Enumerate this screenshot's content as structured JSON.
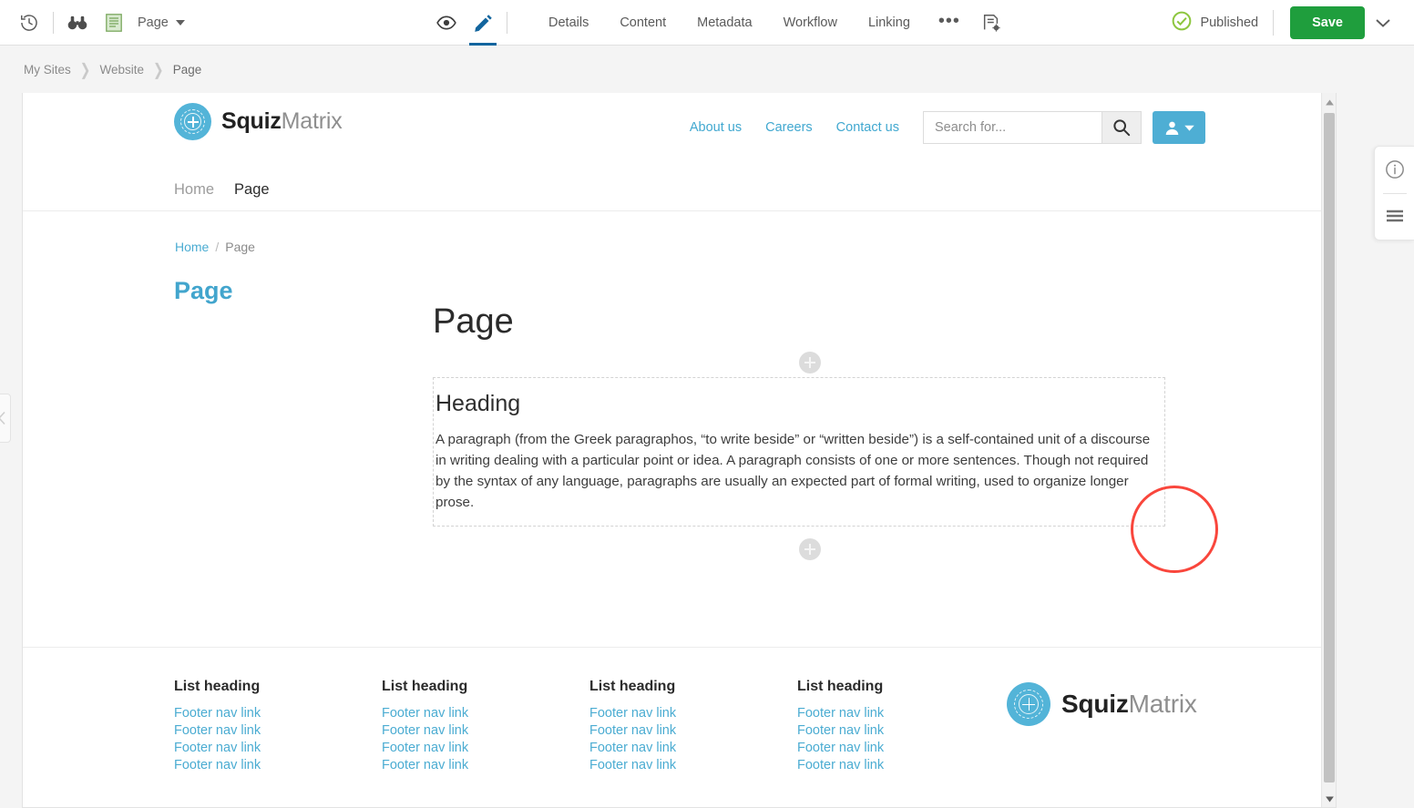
{
  "toolbar": {
    "history_icon": "history-clock-icon",
    "preview_binoculars_icon": "binoculars-icon",
    "asset_type_icon": "page-asset-icon",
    "asset_name": "Page",
    "view_mode_icon": "eye-icon",
    "edit_mode_icon": "pencil-icon",
    "tabs": [
      {
        "label": "Details"
      },
      {
        "label": "Content"
      },
      {
        "label": "Metadata"
      },
      {
        "label": "Workflow"
      },
      {
        "label": "Linking"
      }
    ],
    "more_label": "•••",
    "settings_icon": "page-settings-icon",
    "status_icon": "check-circle-icon",
    "status_label": "Published",
    "save_label": "Save",
    "save_caret_icon": "chevron-down-icon"
  },
  "breadcrumb": {
    "items": [
      {
        "label": "My Sites"
      },
      {
        "label": "Website"
      },
      {
        "label": "Page"
      }
    ],
    "separator": "❯"
  },
  "right_panel": {
    "info_icon": "info-circle-icon",
    "list_icon": "hamburger-list-icon"
  },
  "left_handle": {
    "icon": "chevron-left-icon"
  },
  "preview": {
    "site_header": {
      "logo_text_bold": "Squiz",
      "logo_text_light": "Matrix",
      "logo_icon": "squiz-matrix-logo-icon",
      "util_links": [
        {
          "label": "About us"
        },
        {
          "label": "Careers"
        },
        {
          "label": "Contact us"
        }
      ],
      "search_placeholder": "Search for...",
      "search_value": "",
      "search_icon": "search-magnifier-icon",
      "user_icon": "user-avatar-icon",
      "user_caret_icon": "chevron-down-icon",
      "nav_items": [
        {
          "label": "Home",
          "active": false
        },
        {
          "label": "Page",
          "active": true
        }
      ]
    },
    "body": {
      "breadcrumb_home": "Home",
      "breadcrumb_sep": "/",
      "breadcrumb_current": "Page",
      "side_title": "Page",
      "main_title": "Page",
      "add_button_label": "+",
      "edit_zone": {
        "heading": "Heading",
        "paragraph": "A paragraph (from the Greek paragraphos, “to write beside” or “written beside”) is a self-contained unit of a discourse in writing dealing with a particular point or idea. A paragraph consists of one or more sentences. Though not required by the syntax of any language, paragraphs are usually an expected part of formal writing, used to organize longer prose."
      }
    },
    "footer": {
      "columns": [
        {
          "heading": "List heading",
          "links": [
            {
              "label": "Footer nav link"
            },
            {
              "label": "Footer nav link"
            },
            {
              "label": "Footer nav link"
            },
            {
              "label": "Footer nav link"
            }
          ]
        },
        {
          "heading": "List heading",
          "links": [
            {
              "label": "Footer nav link"
            },
            {
              "label": "Footer nav link"
            },
            {
              "label": "Footer nav link"
            },
            {
              "label": "Footer nav link"
            }
          ]
        },
        {
          "heading": "List heading",
          "links": [
            {
              "label": "Footer nav link"
            },
            {
              "label": "Footer nav link"
            },
            {
              "label": "Footer nav link"
            },
            {
              "label": "Footer nav link"
            }
          ]
        },
        {
          "heading": "List heading",
          "links": [
            {
              "label": "Footer nav link"
            },
            {
              "label": "Footer nav link"
            },
            {
              "label": "Footer nav link"
            },
            {
              "label": "Footer nav link"
            }
          ]
        }
      ],
      "logo_text_bold": "Squiz",
      "logo_text_light": "Matrix",
      "logo_icon": "squiz-matrix-logo-icon"
    },
    "annotation": {
      "shape": "circle",
      "color": "#f9463c"
    },
    "scrollbar": {
      "up_icon": "triangle-up-icon",
      "down_icon": "triangle-down-icon"
    }
  },
  "colors": {
    "accent_blue": "#12659e",
    "brand_cyan": "#4eaed4",
    "link_cyan": "#4bacd2",
    "save_green": "#1f9e3d",
    "published_green": "#8dc63f",
    "annotation_red": "#f9463c"
  }
}
